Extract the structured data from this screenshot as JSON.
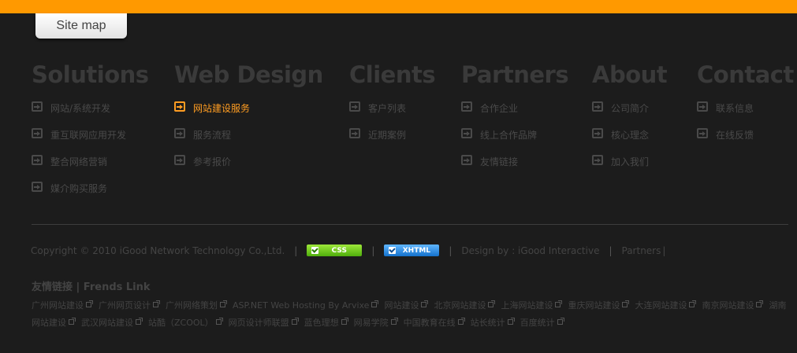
{
  "header": {
    "sitemap_label": "Site map"
  },
  "columns": [
    {
      "heading": "Solutions",
      "items": [
        {
          "label": "网站/系统开发",
          "active": false
        },
        {
          "label": "重互联网应用开发",
          "active": false
        },
        {
          "label": "整合网络营销",
          "active": false
        },
        {
          "label": "媒介购买服务",
          "active": false
        }
      ]
    },
    {
      "heading": "Web Design",
      "items": [
        {
          "label": "网站建设服务",
          "active": true
        },
        {
          "label": "服务流程",
          "active": false
        },
        {
          "label": "参考报价",
          "active": false
        }
      ]
    },
    {
      "heading": "Clients",
      "items": [
        {
          "label": "客户列表",
          "active": false
        },
        {
          "label": "近期案例",
          "active": false
        }
      ]
    },
    {
      "heading": "Partners",
      "items": [
        {
          "label": "合作企业",
          "active": false
        },
        {
          "label": "线上合作品牌",
          "active": false
        },
        {
          "label": "友情链接",
          "active": false
        }
      ]
    },
    {
      "heading": "About",
      "items": [
        {
          "label": "公司简介",
          "active": false
        },
        {
          "label": "核心理念",
          "active": false
        },
        {
          "label": "加入我们",
          "active": false
        }
      ]
    },
    {
      "heading": "Contact",
      "items": [
        {
          "label": "联系信息",
          "active": false
        },
        {
          "label": "在线反馈",
          "active": false
        }
      ]
    }
  ],
  "footer": {
    "copyright": "Copyright © 2010 iGood Network Technology Co.,Ltd.",
    "css_badge": "CSS",
    "xhtml_badge": "XHTML",
    "design_by": "Design by : iGood Interactive",
    "partners": "Partners"
  },
  "friend_links": {
    "title": "友情链接 | Frends Link",
    "items": [
      "广州网站建设",
      "广州网页设计",
      "广州网络策划",
      "ASP.NET Web Hosting By Arvixe",
      "网站建设",
      "北京网站建设",
      "上海网站建设",
      "重庆网站建设",
      "大连网站建设",
      "南京网站建设",
      "湖南网站建设",
      "武汉网站建设",
      "站酷（ZCOOL）",
      "网页设计师联盟",
      "蓝色理想",
      "网易学院",
      "中国教育在线",
      "站长统计",
      "百度统计"
    ]
  },
  "colors": {
    "accent": "#ff9900",
    "background": "#1c1c1c",
    "active_link": "#ff9d22"
  }
}
